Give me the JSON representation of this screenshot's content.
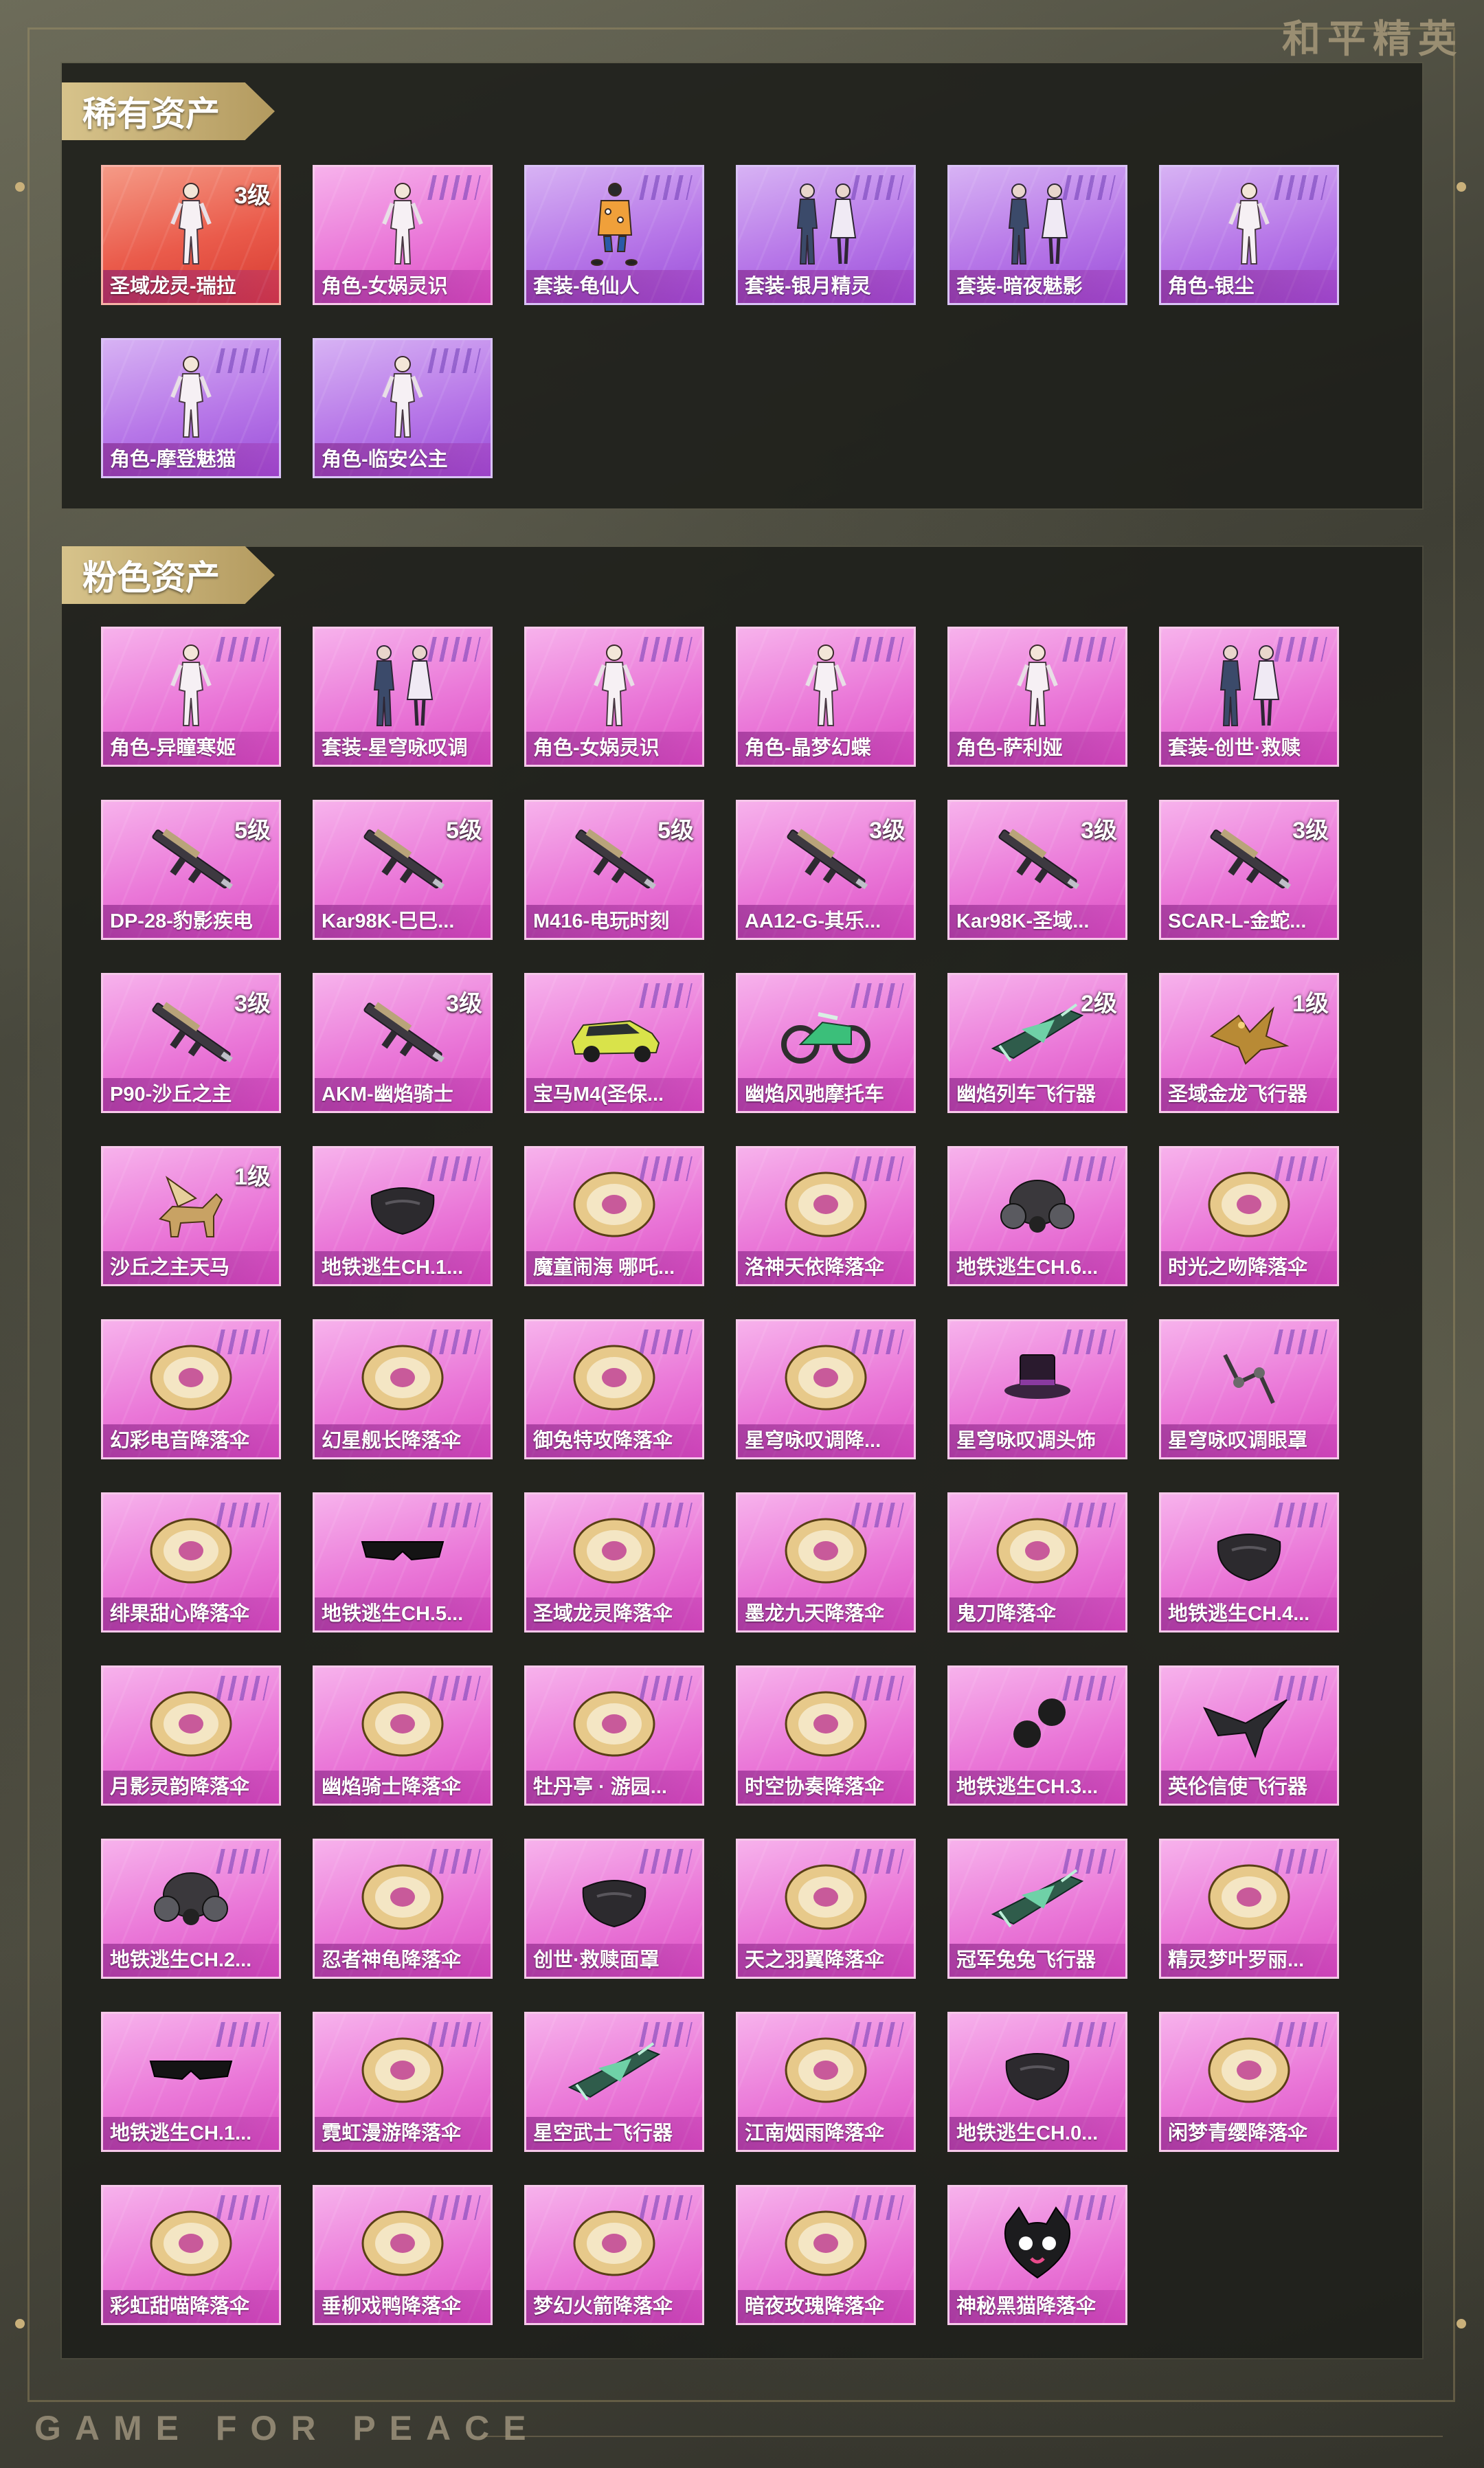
{
  "brand": "和平精英",
  "footer": "GAME FOR PEACE",
  "sections": [
    {
      "title": "稀有资产",
      "items": [
        {
          "label": "圣域龙灵-瑞拉",
          "badge": "3级",
          "color": "red",
          "icon": "character-figure-icon"
        },
        {
          "label": "角色-女娲灵识",
          "badge": "",
          "color": "pink",
          "icon": "character-figure-icon"
        },
        {
          "label": "套装-龟仙人",
          "badge": "",
          "color": "purple",
          "icon": "outfit-icon"
        },
        {
          "label": "套装-银月精灵",
          "badge": "",
          "color": "purple",
          "icon": "couple-figure-icon"
        },
        {
          "label": "套装-暗夜魅影",
          "badge": "",
          "color": "purple",
          "icon": "couple-figure-icon"
        },
        {
          "label": "角色-银尘",
          "badge": "",
          "color": "purple",
          "icon": "character-figure-icon"
        },
        {
          "label": "角色-摩登魅猫",
          "badge": "",
          "color": "purple",
          "icon": "character-figure-icon"
        },
        {
          "label": "角色-临安公主",
          "badge": "",
          "color": "purple",
          "icon": "character-figure-icon"
        }
      ]
    },
    {
      "title": "粉色资产",
      "items": [
        {
          "label": "角色-异瞳寒姬",
          "badge": "",
          "color": "pink",
          "icon": "character-figure-icon"
        },
        {
          "label": "套装-星穹咏叹调",
          "badge": "",
          "color": "pink",
          "icon": "couple-figure-icon"
        },
        {
          "label": "角色-女娲灵识",
          "badge": "",
          "color": "pink",
          "icon": "character-figure-icon"
        },
        {
          "label": "角色-晶梦幻蝶",
          "badge": "",
          "color": "pink",
          "icon": "character-figure-icon"
        },
        {
          "label": "角色-萨利娅",
          "badge": "",
          "color": "pink",
          "icon": "character-figure-icon"
        },
        {
          "label": "套装-创世·救赎",
          "badge": "",
          "color": "pink",
          "icon": "couple-figure-icon"
        },
        {
          "label": "DP-28-豹影疾电",
          "badge": "5级",
          "color": "pink",
          "icon": "rifle-icon"
        },
        {
          "label": "Kar98K-巳巳...",
          "badge": "5级",
          "color": "pink",
          "icon": "rifle-icon"
        },
        {
          "label": "M416-电玩时刻",
          "badge": "5级",
          "color": "pink",
          "icon": "rifle-icon"
        },
        {
          "label": "AA12-G-其乐...",
          "badge": "3级",
          "color": "pink",
          "icon": "rifle-icon"
        },
        {
          "label": "Kar98K-圣域...",
          "badge": "3级",
          "color": "pink",
          "icon": "rifle-icon"
        },
        {
          "label": "SCAR-L-金蛇...",
          "badge": "3级",
          "color": "pink",
          "icon": "rifle-icon"
        },
        {
          "label": "P90-沙丘之主",
          "badge": "3级",
          "color": "pink",
          "icon": "rifle-icon"
        },
        {
          "label": "AKM-幽焰骑士",
          "badge": "3级",
          "color": "pink",
          "icon": "rifle-icon"
        },
        {
          "label": "宝马M4(圣保...",
          "badge": "",
          "color": "pink",
          "icon": "car-icon"
        },
        {
          "label": "幽焰风驰摩托车",
          "badge": "",
          "color": "pink",
          "icon": "motorcycle-icon"
        },
        {
          "label": "幽焰列车飞行器",
          "badge": "2级",
          "color": "pink",
          "icon": "aircraft-icon"
        },
        {
          "label": "圣域金龙飞行器",
          "badge": "1级",
          "color": "pink",
          "icon": "dragon-icon"
        },
        {
          "label": "沙丘之主天马",
          "badge": "1级",
          "color": "pink",
          "icon": "pegasus-icon"
        },
        {
          "label": "地铁逃生CH.1...",
          "badge": "",
          "color": "pink",
          "icon": "mask-icon"
        },
        {
          "label": "魔童闹海 哪吒...",
          "badge": "",
          "color": "pink",
          "icon": "parachute-icon"
        },
        {
          "label": "洛神天依降落伞",
          "badge": "",
          "color": "pink",
          "icon": "parachute-icon"
        },
        {
          "label": "地铁逃生CH.6...",
          "badge": "",
          "color": "pink",
          "icon": "gas-mask-icon"
        },
        {
          "label": "时光之吻降落伞",
          "badge": "",
          "color": "pink",
          "icon": "parachute-icon"
        },
        {
          "label": "幻彩电音降落伞",
          "badge": "",
          "color": "pink",
          "icon": "parachute-icon"
        },
        {
          "label": "幻星舰长降落伞",
          "badge": "",
          "color": "pink",
          "icon": "parachute-icon"
        },
        {
          "label": "御兔特攻降落伞",
          "badge": "",
          "color": "pink",
          "icon": "parachute-icon"
        },
        {
          "label": "星穹咏叹调降...",
          "badge": "",
          "color": "pink",
          "icon": "parachute-icon"
        },
        {
          "label": "星穹咏叹调头饰",
          "badge": "",
          "color": "pink",
          "icon": "hat-icon"
        },
        {
          "label": "星穹咏叹调眼罩",
          "badge": "",
          "color": "pink",
          "icon": "eye-mask-icon"
        },
        {
          "label": "绯果甜心降落伞",
          "badge": "",
          "color": "pink",
          "icon": "parachute-icon"
        },
        {
          "label": "地铁逃生CH.5...",
          "badge": "",
          "color": "pink",
          "icon": "sunglasses-icon"
        },
        {
          "label": "圣域龙灵降落伞",
          "badge": "",
          "color": "pink",
          "icon": "parachute-icon"
        },
        {
          "label": "墨龙九天降落伞",
          "badge": "",
          "color": "pink",
          "icon": "parachute-icon"
        },
        {
          "label": "鬼刀降落伞",
          "badge": "",
          "color": "pink",
          "icon": "parachute-icon"
        },
        {
          "label": "地铁逃生CH.4...",
          "badge": "",
          "color": "pink",
          "icon": "mask-icon"
        },
        {
          "label": "月影灵韵降落伞",
          "badge": "",
          "color": "pink",
          "icon": "parachute-icon"
        },
        {
          "label": "幽焰骑士降落伞",
          "badge": "",
          "color": "pink",
          "icon": "parachute-icon"
        },
        {
          "label": "牡丹亭 · 游园...",
          "badge": "",
          "color": "pink",
          "icon": "parachute-icon"
        },
        {
          "label": "时空协奏降落伞",
          "badge": "",
          "color": "pink",
          "icon": "parachute-icon"
        },
        {
          "label": "地铁逃生CH.3...",
          "badge": "",
          "color": "pink",
          "icon": "gloves-icon"
        },
        {
          "label": "英伦信使飞行器",
          "badge": "",
          "color": "pink",
          "icon": "bird-icon"
        },
        {
          "label": "地铁逃生CH.2...",
          "badge": "",
          "color": "pink",
          "icon": "gas-mask-icon"
        },
        {
          "label": "忍者神龟降落伞",
          "badge": "",
          "color": "pink",
          "icon": "parachute-icon"
        },
        {
          "label": "创世·救赎面罩",
          "badge": "",
          "color": "pink",
          "icon": "mask-icon"
        },
        {
          "label": "天之羽翼降落伞",
          "badge": "",
          "color": "pink",
          "icon": "parachute-icon"
        },
        {
          "label": "冠军兔兔飞行器",
          "badge": "",
          "color": "pink",
          "icon": "aircraft-icon"
        },
        {
          "label": "精灵梦叶罗丽...",
          "badge": "",
          "color": "pink",
          "icon": "parachute-icon"
        },
        {
          "label": "地铁逃生CH.1...",
          "badge": "",
          "color": "pink",
          "icon": "sunglasses-icon"
        },
        {
          "label": "霓虹漫游降落伞",
          "badge": "",
          "color": "pink",
          "icon": "parachute-icon"
        },
        {
          "label": "星空武士飞行器",
          "badge": "",
          "color": "pink",
          "icon": "aircraft-icon"
        },
        {
          "label": "江南烟雨降落伞",
          "badge": "",
          "color": "pink",
          "icon": "parachute-icon"
        },
        {
          "label": "地铁逃生CH.0...",
          "badge": "",
          "color": "pink",
          "icon": "mask-icon"
        },
        {
          "label": "闲梦青缨降落伞",
          "badge": "",
          "color": "pink",
          "icon": "parachute-icon"
        },
        {
          "label": "彩虹甜喵降落伞",
          "badge": "",
          "color": "pink",
          "icon": "parachute-icon"
        },
        {
          "label": "垂柳戏鸭降落伞",
          "badge": "",
          "color": "pink",
          "icon": "parachute-icon"
        },
        {
          "label": "梦幻火箭降落伞",
          "badge": "",
          "color": "pink",
          "icon": "parachute-icon"
        },
        {
          "label": "暗夜玫瑰降落伞",
          "badge": "",
          "color": "pink",
          "icon": "parachute-icon"
        },
        {
          "label": "神秘黑猫降落伞",
          "badge": "",
          "color": "pink",
          "icon": "cat-icon"
        }
      ]
    }
  ]
}
